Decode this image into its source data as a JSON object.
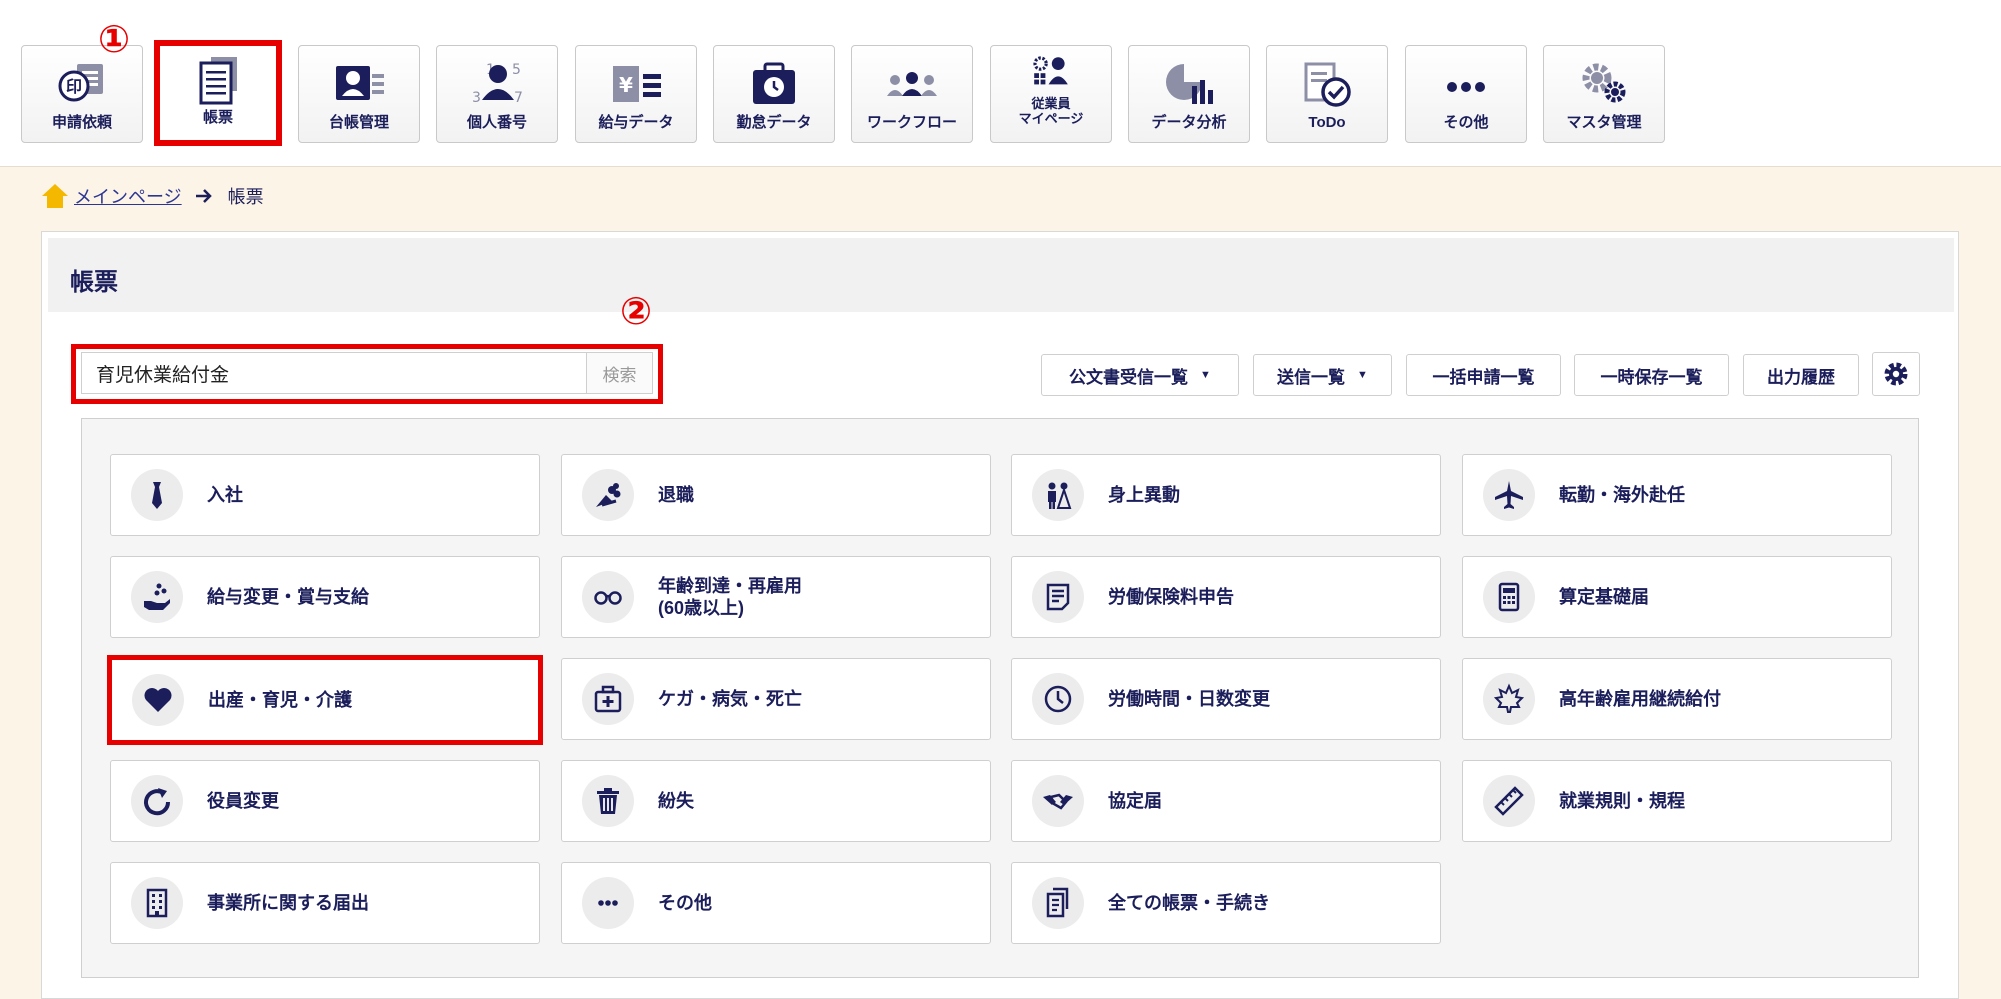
{
  "markers": {
    "one": "①",
    "two": "②"
  },
  "nav": {
    "items": [
      {
        "label": "申請依頼"
      },
      {
        "label": "帳票"
      },
      {
        "label": "台帳管理"
      },
      {
        "label": "個人番号"
      },
      {
        "label": "給与データ"
      },
      {
        "label": "勤怠データ"
      },
      {
        "label": "ワークフロー"
      },
      {
        "label": "従業員\nマイページ"
      },
      {
        "label": "データ分析"
      },
      {
        "label": "ToDo"
      },
      {
        "label": "その他"
      },
      {
        "label": "マスタ管理"
      }
    ],
    "active_index": 1,
    "icon_badge": "印",
    "icon_yen": "¥",
    "icon_digits": [
      "1",
      "5",
      "3",
      "7"
    ]
  },
  "breadcrumb": {
    "home": "メインページ",
    "current": "帳票"
  },
  "page": {
    "title": "帳票"
  },
  "search": {
    "value": "育児休業給付金",
    "button": "検索"
  },
  "toolbar": {
    "buttons": [
      {
        "label": "公文書受信一覧",
        "dropdown": true
      },
      {
        "label": "送信一覧",
        "dropdown": true
      },
      {
        "label": "一括申請一覧",
        "dropdown": false
      },
      {
        "label": "一時保存一覧",
        "dropdown": false
      },
      {
        "label": "出力履歴",
        "dropdown": false
      }
    ]
  },
  "categories": [
    {
      "label": "入社",
      "icon": "necktie-icon"
    },
    {
      "label": "退職",
      "icon": "bouquet-icon"
    },
    {
      "label": "身上異動",
      "icon": "wedding-couple-icon"
    },
    {
      "label": "転勤・海外赴任",
      "icon": "airplane-icon"
    },
    {
      "label": "給与変更・賞与支給",
      "icon": "hand-coins-icon"
    },
    {
      "label": "年齢到達・再雇用\n(60歳以上)",
      "icon": "glasses-icon"
    },
    {
      "label": "労働保険料申告",
      "icon": "document-icon"
    },
    {
      "label": "算定基礎届",
      "icon": "calculator-icon"
    },
    {
      "label": "出産・育児・介護",
      "icon": "heart-icon"
    },
    {
      "label": "ケガ・病気・死亡",
      "icon": "first-aid-kit-icon"
    },
    {
      "label": "労働時間・日数変更",
      "icon": "clock-icon"
    },
    {
      "label": "高年齢雇用継続給付",
      "icon": "maple-leaf-icon"
    },
    {
      "label": "役員変更",
      "icon": "refresh-icon"
    },
    {
      "label": "紛失",
      "icon": "trash-icon"
    },
    {
      "label": "協定届",
      "icon": "handshake-icon"
    },
    {
      "label": "就業規則・規程",
      "icon": "ruler-icon"
    },
    {
      "label": "事業所に関する届出",
      "icon": "building-icon"
    },
    {
      "label": "その他",
      "icon": "more-icon"
    },
    {
      "label": "全ての帳票・手続き",
      "icon": "documents-icon"
    }
  ],
  "highlighted_category_index": 8,
  "colors": {
    "accent": "#1b1e5a",
    "highlight": "#e60000",
    "background": "#fdf4e8"
  }
}
